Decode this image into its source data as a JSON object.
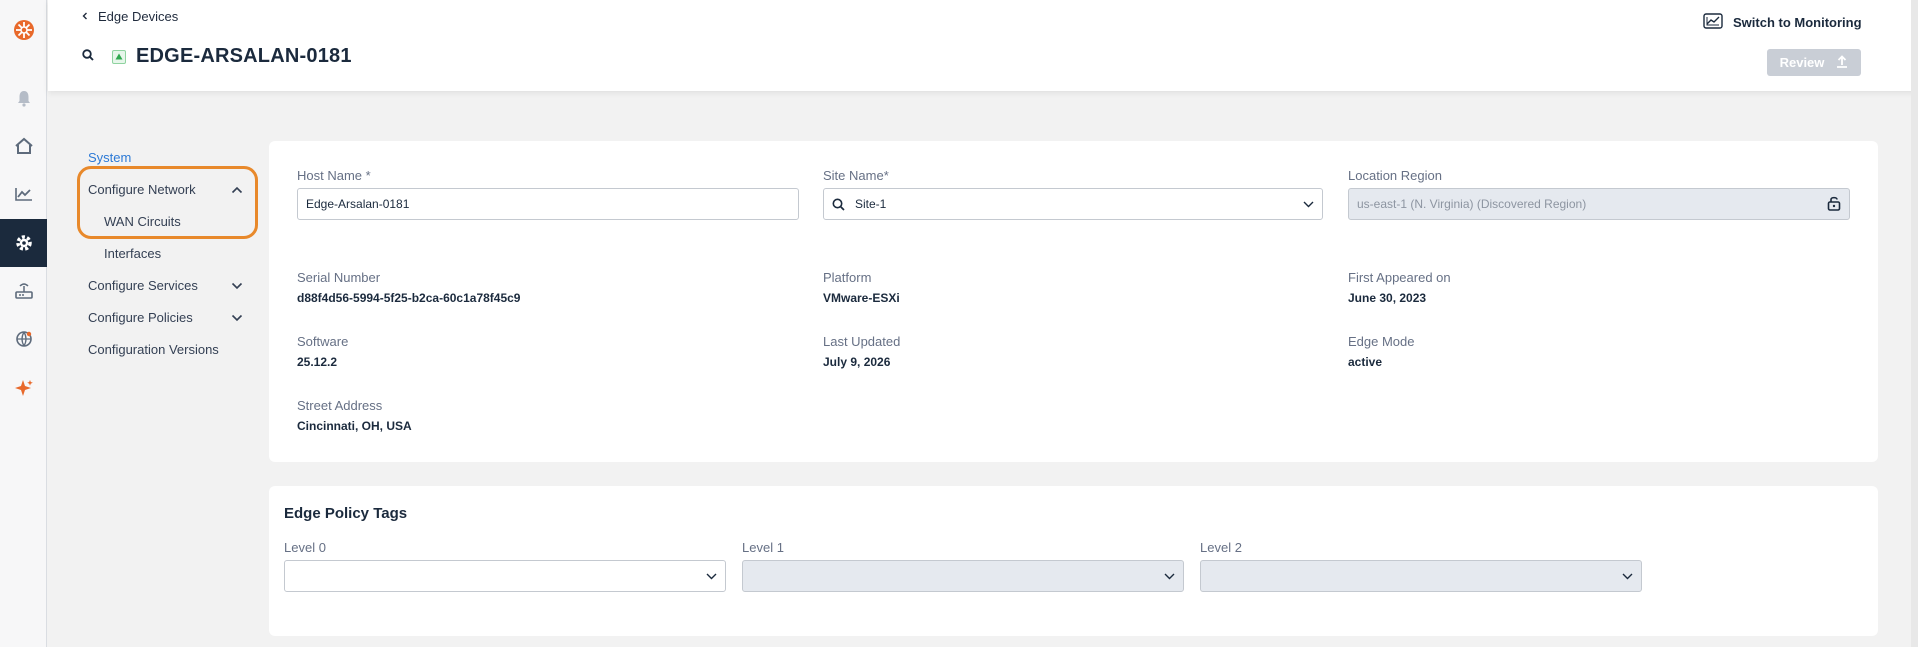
{
  "header": {
    "breadcrumb": "Edge Devices",
    "title": "EDGE-ARSALAN-0181",
    "switch_label": "Switch to Monitoring",
    "review_label": "Review"
  },
  "rail": {
    "icons": [
      "logo-icon",
      "bell-icon",
      "home-icon",
      "chart-icon",
      "gear-icon",
      "router-icon",
      "globe-icon",
      "sparkle-icon"
    ],
    "active": "gear-icon",
    "accent": "#e8692b"
  },
  "nav": {
    "system": "System",
    "configure_network": "Configure Network",
    "wan_circuits": "WAN Circuits",
    "interfaces": "Interfaces",
    "configure_services": "Configure Services",
    "configure_policies": "Configure Policies",
    "configuration_versions": "Configuration Versions"
  },
  "details": {
    "host_name_label": "Host Name *",
    "host_name_value": "Edge-Arsalan-0181",
    "site_name_label": "Site Name*",
    "site_name_value": "Site-1",
    "location_region_label": "Location Region",
    "location_region_value": "us-east-1 (N. Virginia) (Discovered Region)",
    "serial_number_label": "Serial Number",
    "serial_number_value": "d88f4d56-5994-5f25-b2ca-60c1a78f45c9",
    "platform_label": "Platform",
    "platform_value": "VMware-ESXi",
    "first_appeared_label": "First Appeared on",
    "first_appeared_value": "June 30, 2023",
    "software_label": "Software",
    "software_value": "25.12.2",
    "last_updated_label": "Last Updated",
    "last_updated_value": "July 9, 2026",
    "edge_mode_label": "Edge Mode",
    "edge_mode_value": "active",
    "street_address_label": "Street Address",
    "street_address_value": "Cincinnati, OH, USA"
  },
  "policy_tags": {
    "title": "Edge Policy Tags",
    "level0_label": "Level 0",
    "level1_label": "Level 1",
    "level2_label": "Level 2"
  }
}
